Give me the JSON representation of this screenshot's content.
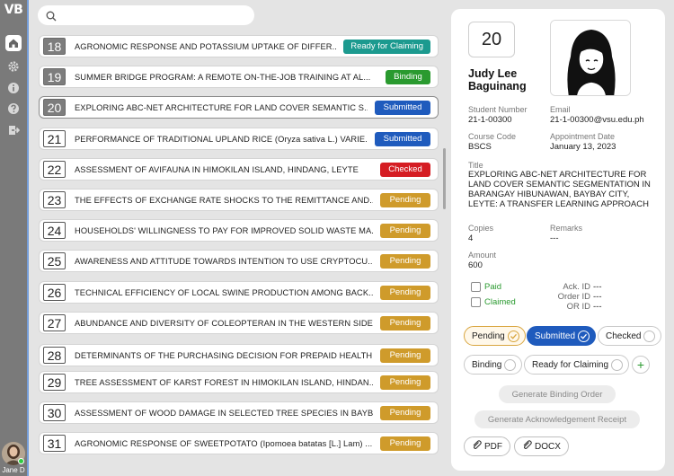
{
  "app": {
    "logo": "VB"
  },
  "sidebar": {
    "icons": [
      "home-icon",
      "gear-icon",
      "info-icon",
      "help-icon",
      "logout-icon"
    ],
    "user": {
      "name": "Jane D"
    }
  },
  "search": {
    "placeholder": "",
    "value": ""
  },
  "list": [
    {
      "num": "18",
      "title": "AGRONOMIC RESPONSE AND POTASSIUM UPTAKE OF DIFFER...",
      "status": "Ready for Claiming"
    },
    {
      "num": "19",
      "title": "SUMMER BRIDGE PROGRAM: A REMOTE ON-THE-JOB TRAINING AT AL...",
      "status": "Binding"
    },
    {
      "num": "20",
      "title": "EXPLORING ABC-NET ARCHITECTURE FOR LAND COVER SEMANTIC S...",
      "status": "Submitted"
    },
    {
      "num": "21",
      "title": "PERFORMANCE OF TRADITIONAL UPLAND RICE (Oryza sativa L.) VARIE...",
      "status": "Submitted"
    },
    {
      "num": "22",
      "title": "ASSESSMENT OF AVIFAUNA IN HIMOKILAN ISLAND, HINDANG, LEYTE",
      "status": "Checked"
    },
    {
      "num": "23",
      "title": "THE EFFECTS OF EXCHANGE RATE SHOCKS TO THE REMITTANCE AND...",
      "status": "Pending"
    },
    {
      "num": "24",
      "title": "HOUSEHOLDS' WILLINGNESS TO PAY FOR IMPROVED SOLID WASTE MA...",
      "status": "Pending"
    },
    {
      "num": "25",
      "title": "AWARENESS AND ATTITUDE TOWARDS INTENTION TO USE CRYPTOCU...",
      "status": "Pending"
    },
    {
      "num": "26",
      "title": "TECHNICAL EFFICIENCY OF LOCAL SWINE PRODUCTION AMONG BACK...",
      "status": "Pending"
    },
    {
      "num": "27",
      "title": "ABUNDANCE AND DIVERSITY OF COLEOPTERAN IN THE WESTERN SIDE...",
      "status": "Pending"
    },
    {
      "num": "28",
      "title": "DETERMINANTS OF THE PURCHASING DECISION FOR PREPAID HEALTH...",
      "status": "Pending"
    },
    {
      "num": "29",
      "title": "TREE ASSESSMENT OF KARST FOREST IN HIMOKILAN ISLAND, HINDAN...",
      "status": "Pending"
    },
    {
      "num": "30",
      "title": "ASSESSMENT OF WOOD DAMAGE IN SELECTED TREE SPECIES IN BAYB...",
      "status": "Pending"
    },
    {
      "num": "31",
      "title": "AGRONOMIC RESPONSE OF SWEETPOTATO (Ipomoea batatas [L.] Lam) ...",
      "status": "Pending"
    }
  ],
  "detail": {
    "num": "20",
    "name": "Judy Lee Baguinang",
    "student_number_label": "Student Number",
    "student_number": "21-1-00300",
    "email_label": "Email",
    "email": "21-1-00300@vsu.edu.ph",
    "course_label": "Course Code",
    "course": "BSCS",
    "appointment_label": "Appointment Date",
    "appointment": "January 13, 2023",
    "title_label": "Title",
    "title": "EXPLORING ABC-NET ARCHITECTURE FOR LAND COVER SEMANTIC SEGMENTATION IN BARANGAY HIBUNAWAN, BAYBAY CITY, LEYTE: A TRANSFER LEARNING APPROACH",
    "copies_label": "Copies",
    "copies": "4",
    "remarks_label": "Remarks",
    "remarks": "---",
    "amount_label": "Amount",
    "amount": "600",
    "paid_label": "Paid",
    "claimed_label": "Claimed",
    "ack_id_label": "Ack. ID",
    "ack_id": "---",
    "order_id_label": "Order ID",
    "order_id": "---",
    "or_id_label": "OR ID",
    "or_id": "---",
    "status_buttons": {
      "pending": "Pending",
      "submitted": "Submitted",
      "checked": "Checked",
      "binding": "Binding",
      "ready": "Ready for Claiming",
      "plus": "+"
    },
    "generate_binding": "Generate Binding Order",
    "generate_ack": "Generate Acknowledgement Receipt",
    "pdf": "PDF",
    "docx": "DOCX"
  },
  "colors": {
    "pending": "#cf9b2b",
    "submitted": "#1f5bbd",
    "checked": "#d51d23",
    "binding": "#2a9a2f",
    "ready": "#1c9a8f"
  }
}
